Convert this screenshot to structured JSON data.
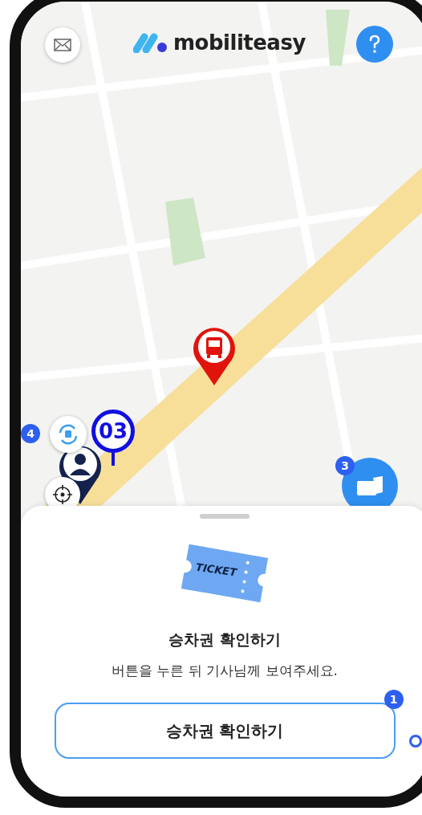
{
  "header": {
    "logo": "mobiliteasy"
  },
  "map": {
    "route_marker": {
      "label": "03"
    },
    "transfer_button": {
      "badge": "4"
    },
    "ticket_button": {
      "badge": "3"
    }
  },
  "sheet": {
    "ticket_label": "TICKET",
    "title": "승차권 확인하기",
    "subtitle": "버튼을 누른 뒤 기사님께 보여주세요.",
    "button": {
      "label": "승차권 확인하기",
      "badge": "1"
    }
  }
}
